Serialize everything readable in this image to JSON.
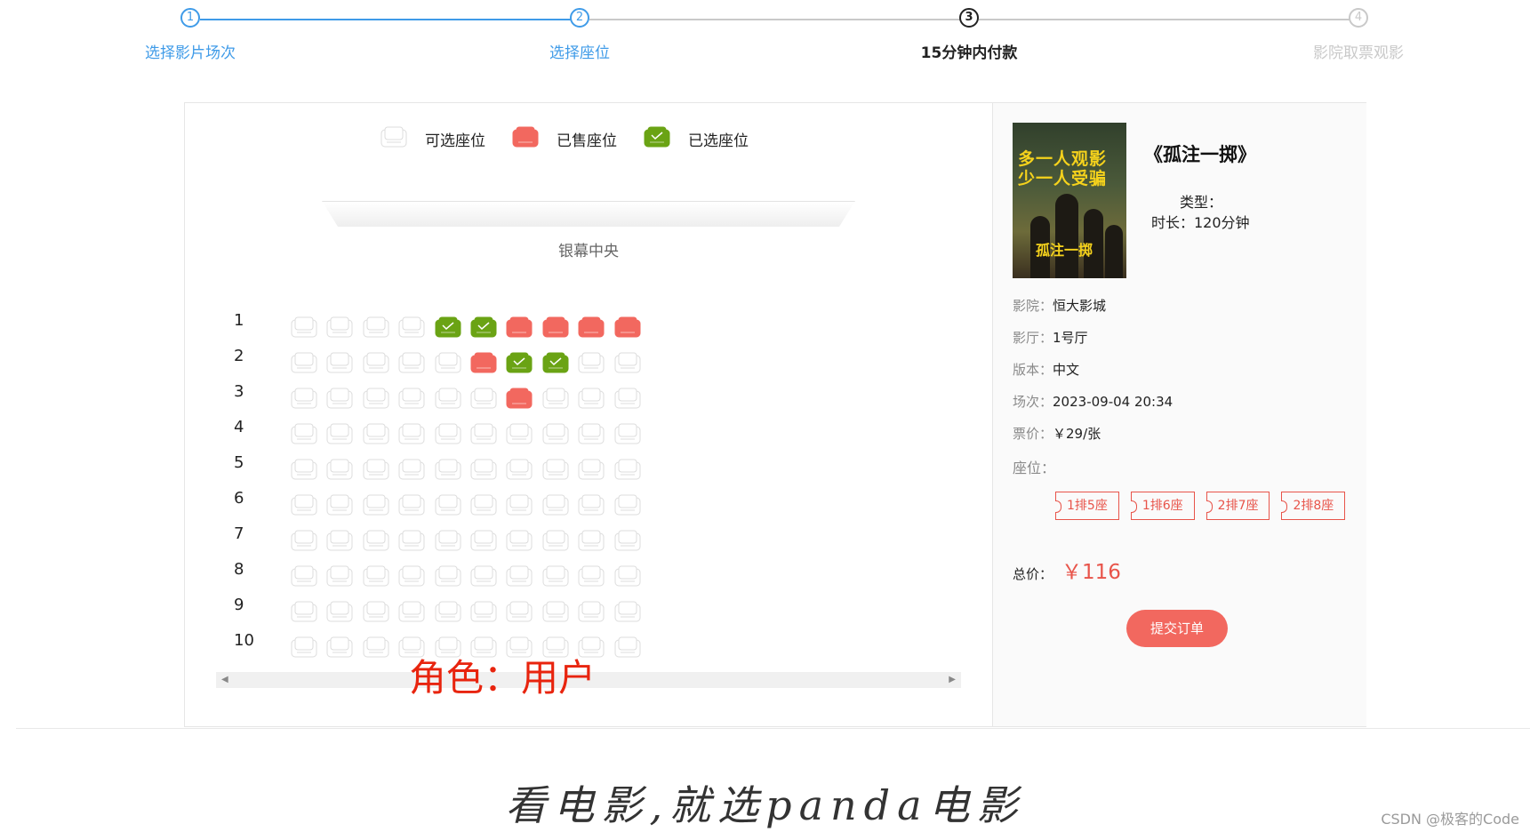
{
  "steps": [
    {
      "num": "1",
      "label": "选择影片场次",
      "state": "done"
    },
    {
      "num": "2",
      "label": "选择座位",
      "state": "done"
    },
    {
      "num": "3",
      "label": "15分钟内付款",
      "state": "active"
    },
    {
      "num": "4",
      "label": "影院取票观影",
      "state": "todo"
    }
  ],
  "legend": {
    "available": "可选座位",
    "sold": "已售座位",
    "selected": "已选座位"
  },
  "screen_label": "银幕中央",
  "rows": [
    "1",
    "2",
    "3",
    "4",
    "5",
    "6",
    "7",
    "8",
    "9",
    "10"
  ],
  "seat_states": [
    [
      "available",
      "available",
      "available",
      "available",
      "selected",
      "selected",
      "sold",
      "sold",
      "sold",
      "sold"
    ],
    [
      "available",
      "available",
      "available",
      "available",
      "available",
      "sold",
      "selected",
      "selected",
      "available",
      "available"
    ],
    [
      "available",
      "available",
      "available",
      "available",
      "available",
      "available",
      "sold",
      "available",
      "available",
      "available"
    ],
    [
      "available",
      "available",
      "available",
      "available",
      "available",
      "available",
      "available",
      "available",
      "available",
      "available"
    ],
    [
      "available",
      "available",
      "available",
      "available",
      "available",
      "available",
      "available",
      "available",
      "available",
      "available"
    ],
    [
      "available",
      "available",
      "available",
      "available",
      "available",
      "available",
      "available",
      "available",
      "available",
      "available"
    ],
    [
      "available",
      "available",
      "available",
      "available",
      "available",
      "available",
      "available",
      "available",
      "available",
      "available"
    ],
    [
      "available",
      "available",
      "available",
      "available",
      "available",
      "available",
      "available",
      "available",
      "available",
      "available"
    ],
    [
      "available",
      "available",
      "available",
      "available",
      "available",
      "available",
      "available",
      "available",
      "available",
      "available"
    ],
    [
      "available",
      "available",
      "available",
      "available",
      "available",
      "available",
      "available",
      "available",
      "available",
      "available"
    ]
  ],
  "role_label": "角色：用户",
  "movie": {
    "poster_line1": "多一人观影",
    "poster_line2": "少一人受骗",
    "poster_title": "孤注一掷",
    "title": "《孤注一掷》",
    "type_label": "类型：",
    "duration": "时长：120分钟"
  },
  "details": [
    {
      "key": "影院：",
      "value": "恒大影城"
    },
    {
      "key": "影厅：",
      "value": "1号厅"
    },
    {
      "key": "版本：",
      "value": "中文"
    },
    {
      "key": "场次：",
      "value": "2023-09-04 20:34"
    },
    {
      "key": "票价：",
      "value": "￥29/张"
    },
    {
      "key": "座位：",
      "value": ""
    }
  ],
  "tickets": [
    "1排5座",
    "1排6座",
    "2排7座",
    "2排8座"
  ],
  "total": {
    "key": "总价：",
    "value": "￥116"
  },
  "submit_label": "提交订单",
  "slogan": "看电影,就选panda电影",
  "watermark": "CSDN @极客的Code",
  "colors": {
    "step_done": "#3f9be8",
    "sold": "#f2685f",
    "selected": "#6aa314",
    "accent": "#e8544a"
  }
}
